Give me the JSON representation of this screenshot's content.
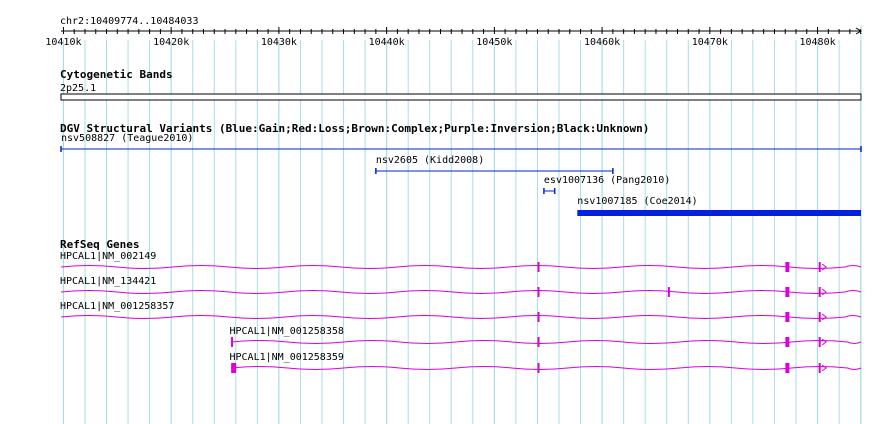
{
  "region": "chr2:10409774..10484033",
  "ruler": {
    "labels": [
      "10410k",
      "10420k",
      "10430k",
      "10440k",
      "10450k",
      "10460k",
      "10470k",
      "10480k"
    ]
  },
  "tracks": {
    "cytoband": {
      "title": "Cytogenetic Bands",
      "band": "2p25.1"
    },
    "dgv": {
      "title": "DGV Structural Variants (Blue:Gain;Red:Loss;Brown:Complex;Purple:Inversion;Black:Unknown)",
      "features": [
        {
          "label": "nsv508827 (Teague2010)",
          "start": 10409774,
          "end": 10484033,
          "type": "gain",
          "style": "line"
        },
        {
          "label": "nsv2605 (Kidd2008)",
          "start": 10439000,
          "end": 10461000,
          "type": "gain",
          "style": "line"
        },
        {
          "label": "esv1007136 (Pang2010)",
          "start": 10454600,
          "end": 10455600,
          "type": "gain",
          "style": "line"
        },
        {
          "label": "nsv1007185 (Coe2014)",
          "start": 10457700,
          "end": 10484033,
          "type": "gain",
          "style": "bar"
        }
      ]
    },
    "refseq": {
      "title": "RefSeq Genes",
      "transcripts": [
        {
          "label": "HPCAL1|NM_002149",
          "start": 10409774,
          "end": 10484033,
          "exons": [
            10454100,
            10477200,
            10480200
          ]
        },
        {
          "label": "HPCAL1|NM_134421",
          "start": 10409774,
          "end": 10484033,
          "exons": [
            10454100,
            10466200,
            10477200,
            10480200
          ]
        },
        {
          "label": "HPCAL1|NM_001258357",
          "start": 10409774,
          "end": 10484033,
          "exons": [
            10454100,
            10477200,
            10480200
          ]
        },
        {
          "label": "HPCAL1|NM_001258358",
          "start": 10425600,
          "end": 10484033,
          "exons": [
            10425650,
            10454100,
            10477200,
            10480200
          ]
        },
        {
          "label": "HPCAL1|NM_001258359",
          "start": 10425600,
          "end": 10484033,
          "exons": [
            10425800,
            10454100,
            10477200,
            10480200
          ]
        }
      ]
    }
  },
  "colors": {
    "grid": "#a8dce8",
    "gain": "#0022dd",
    "gene": "#dd00dd",
    "text": "#000000"
  }
}
